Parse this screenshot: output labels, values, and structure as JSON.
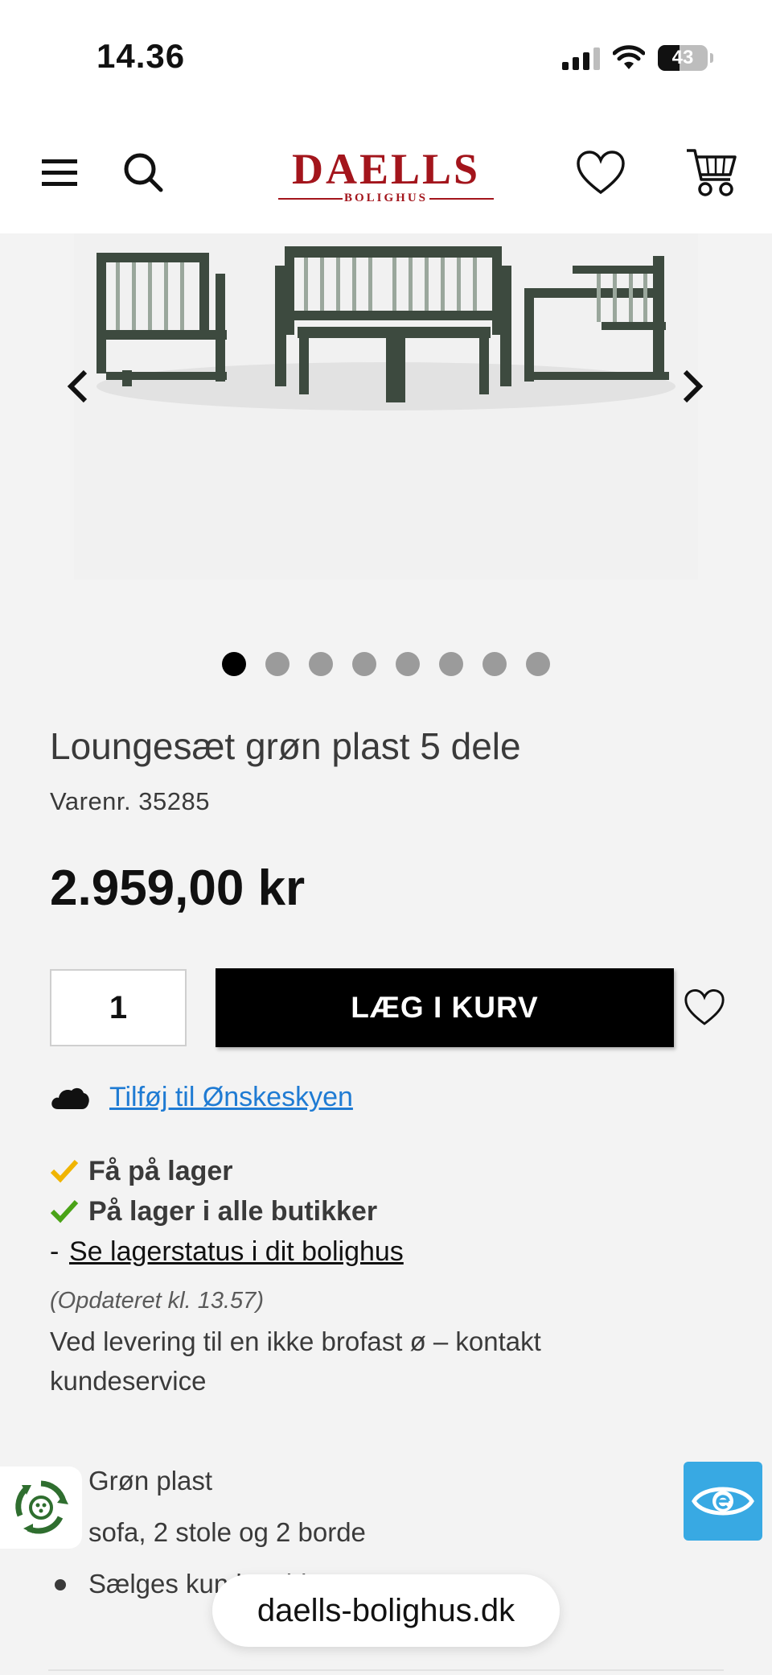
{
  "status_bar": {
    "time": "14.36",
    "battery": "43",
    "battery_level": 0.43
  },
  "header": {
    "logo_text": "DAELLS",
    "logo_subtext": "BOLIGHUS",
    "brand_color": "#a3151c",
    "icons": [
      "menu-icon",
      "search-icon",
      "heart-icon",
      "cart-icon"
    ]
  },
  "gallery": {
    "image_count": 8,
    "active_index": 0
  },
  "product": {
    "title": "Loungesæt grøn plast 5 dele",
    "sku": "Varenr. 35285",
    "price": "2.959,00 kr"
  },
  "purchase": {
    "quantity": "1",
    "add_to_cart_label": "LÆG I KURV"
  },
  "wishcloud": {
    "link_text": "Tilføj til Ønskeskyen",
    "link_color": "#1f7bd3"
  },
  "stock": {
    "online": "Få på lager",
    "online_check_color": "#f0b400",
    "stores": "På lager i alle butikker",
    "stores_check_color": "#4aa317",
    "store_prefix": "-",
    "store_link": "Se lagerstatus i dit bolighus",
    "updated": "(Opdateret kl. 13.57)",
    "delivery_note": "Ved levering til en ikke brofast ø – kontakt kundeservice"
  },
  "features": [
    {
      "text": "Grøn plast"
    },
    {
      "text": "sofa, 2 stole og 2 borde"
    },
    {
      "text": "Sælges kun kombiet"
    }
  ],
  "browser": {
    "url": "daells-bolighus.dk"
  },
  "accessibility_button_color": "#38a9e3"
}
